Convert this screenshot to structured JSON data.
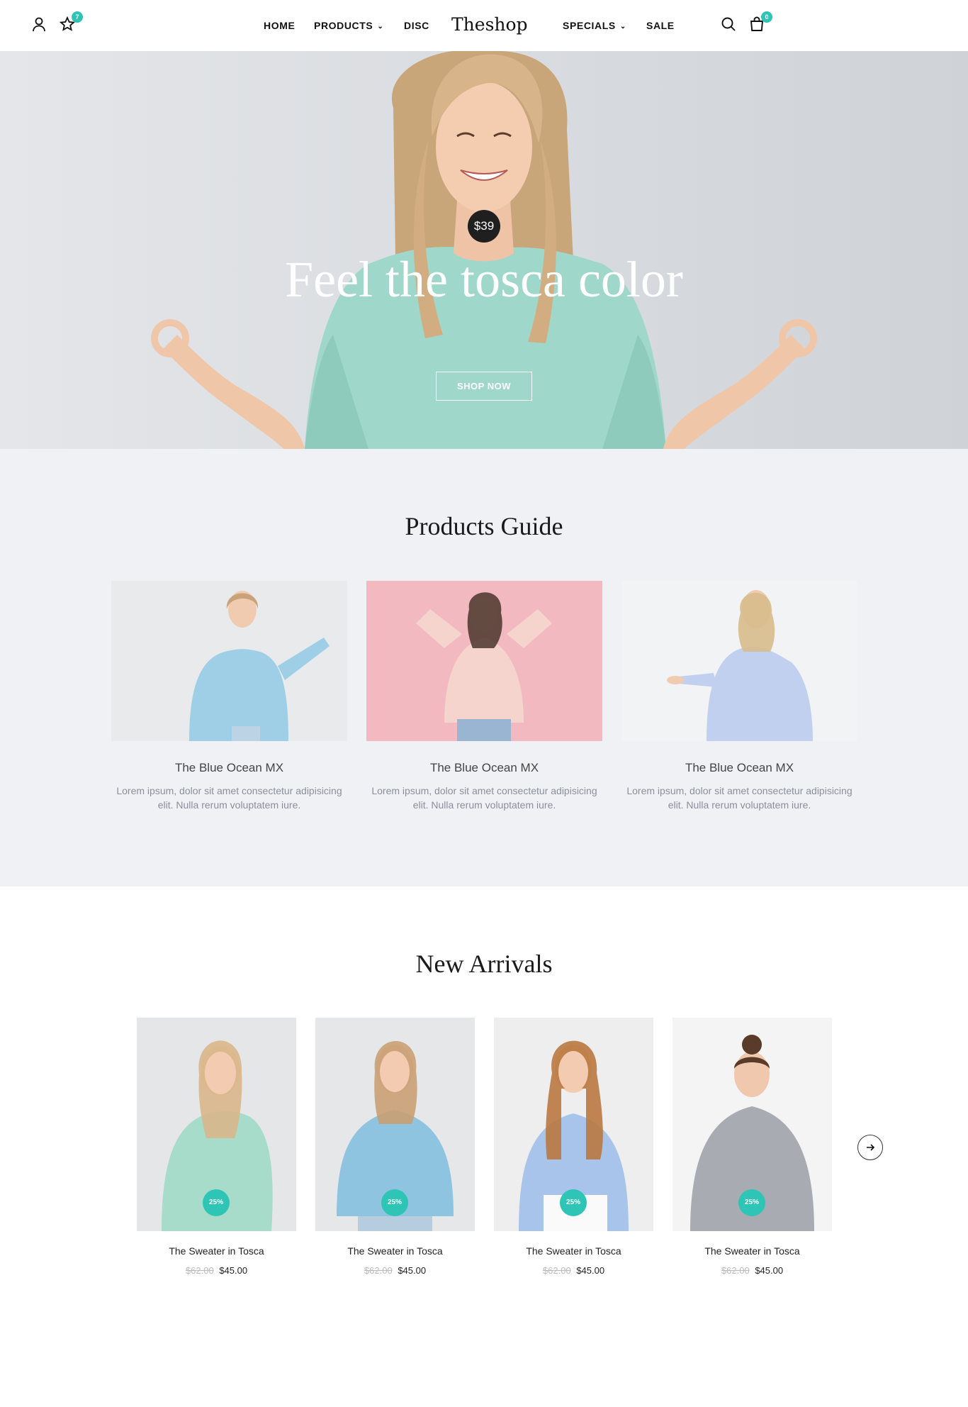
{
  "header": {
    "logo": "Theshop",
    "wishlist_count": "7",
    "cart_count": "0",
    "nav": [
      {
        "label": "HOME"
      },
      {
        "label": "PRODUCTS"
      },
      {
        "label": "DISC"
      },
      {
        "label": "SPECIALS"
      },
      {
        "label": "SALE"
      }
    ],
    "icons": [
      "user-icon",
      "star-icon",
      "search-icon",
      "cart-icon"
    ]
  },
  "hero": {
    "price": "$39",
    "title": "Feel the tosca color",
    "button": "SHOP NOW"
  },
  "guide": {
    "title": "Products Guide",
    "items": [
      {
        "name": "The Blue Ocean MX",
        "desc": "Lorem ipsum, dolor sit amet consectetur adipisicing elit. Nulla rerum voluptatem iure."
      },
      {
        "name": "The Blue Ocean MX",
        "desc": "Lorem ipsum, dolor sit amet consectetur adipisicing elit. Nulla rerum voluptatem iure."
      },
      {
        "name": "The Blue Ocean MX",
        "desc": "Lorem ipsum, dolor sit amet consectetur adipisicing elit. Nulla rerum voluptatem iure."
      }
    ]
  },
  "arrivals": {
    "title": "New Arrivals",
    "products": [
      {
        "name": "The Sweater in Tosca",
        "old_price": "$62.00",
        "price": "$45.00",
        "discount": "25%"
      },
      {
        "name": "The Sweater in Tosca",
        "old_price": "$62.00",
        "price": "$45.00",
        "discount": "25%"
      },
      {
        "name": "The Sweater in Tosca",
        "old_price": "$62.00",
        "price": "$45.00",
        "discount": "25%"
      },
      {
        "name": "The Sweater in Tosca",
        "old_price": "$62.00",
        "price": "$45.00",
        "discount": "25%"
      }
    ],
    "next_icon": "arrow-right-icon"
  },
  "colors": {
    "accent": "#2ec4b6",
    "guide_bg": "#f0f1f5",
    "dark": "#1f1f1f"
  }
}
